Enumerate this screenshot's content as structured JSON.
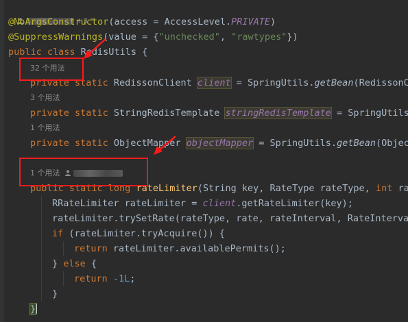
{
  "header": {
    "author_suffix": "+3 *"
  },
  "code": {
    "line1": {
      "annotation": "@NoArgsConstructor",
      "args_open": "(access = AccessLevel.",
      "const": "PRIVATE",
      "close": ")"
    },
    "line2": {
      "annotation": "@SuppressWarnings",
      "args_open": "(value = {",
      "s1": "\"unchecked\"",
      "sep": ", ",
      "s2": "\"rawtypes\"",
      "close": "})"
    },
    "line3": {
      "kw": "public class ",
      "name": "RedisUtils {"
    },
    "hint1": "32 个用法",
    "line4": {
      "kw": "private static ",
      "type": "RedissonClient ",
      "field": "client",
      "eq": " = SpringUtils.",
      "method": "getBean",
      "rest": "(RedissonCl"
    },
    "hint2": "3 个用法",
    "line5": {
      "kw": "private static ",
      "type": "StringRedisTemplate ",
      "field": "stringRedisTemplate",
      "eq": " = SpringUtils."
    },
    "hint3": "1 个用法",
    "line6": {
      "kw": "private static ",
      "type": "ObjectMapper ",
      "field": "objectMapper",
      "eq": " = SpringUtils.",
      "method": "getBean",
      "rest": "(Object"
    },
    "hint4": "1 个用法",
    "line7": {
      "kw": "public static long ",
      "method": "rateLimiter",
      "params1": "(String key, RateType rateType, ",
      "kw2": "int ",
      "params2": "rat"
    },
    "line8": {
      "text1": "RRateLimiter rateLimiter = ",
      "field": "client",
      "text2": ".getRateLimiter(key);"
    },
    "line9": {
      "text": "rateLimiter.trySetRate(rateType, rate, rateInterval, RateInterval"
    },
    "line10": {
      "kw": "if ",
      "text": "(rateLimiter.tryAcquire()) {"
    },
    "line11": {
      "kw": "return ",
      "text": "rateLimiter.availablePermits();"
    },
    "line12": {
      "text1": "} ",
      "kw": "else ",
      "text2": "{"
    },
    "line13": {
      "kw": "return ",
      "num": "-1L",
      "text": ";"
    },
    "line14": {
      "text": "}"
    },
    "line15": {
      "text": "}"
    }
  },
  "colors": {
    "background": "#2b2b2b",
    "keyword": "#cc7832",
    "annotation": "#bbb529",
    "string": "#6a8759",
    "field": "#9876aa",
    "method": "#ffc66d",
    "number": "#6897bb",
    "highlight_box": "#ff1a1a"
  }
}
